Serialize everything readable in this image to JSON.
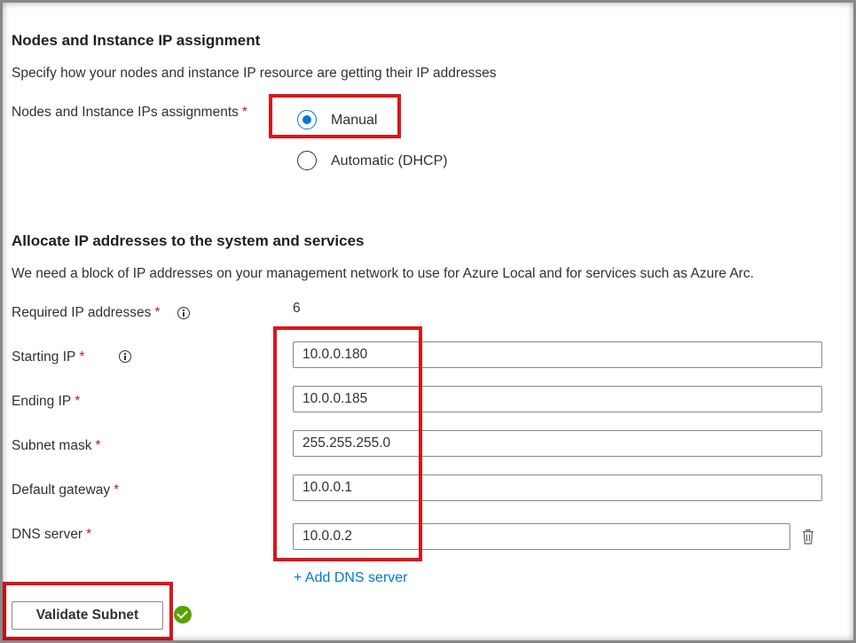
{
  "nodes_section": {
    "heading": "Nodes and Instance IP assignment",
    "description": "Specify how your nodes and instance IP resource are getting their IP addresses",
    "assignment_label": "Nodes and Instance IPs assignments",
    "required_marker": "*",
    "options": [
      {
        "label": "Manual",
        "selected": true
      },
      {
        "label": "Automatic (DHCP)",
        "selected": false
      }
    ]
  },
  "allocate_section": {
    "heading": "Allocate IP addresses to the system and services",
    "description": "We need a block of IP addresses on your management network to use for Azure Local and for services such as Azure Arc.",
    "required_ip_label": "Required IP addresses",
    "required_ip_value": "6",
    "fields": {
      "starting_ip": {
        "label": "Starting IP",
        "value": "10.0.0.180"
      },
      "ending_ip": {
        "label": "Ending IP",
        "value": "10.0.0.185"
      },
      "subnet_mask": {
        "label": "Subnet mask",
        "value": "255.255.255.0"
      },
      "default_gateway": {
        "label": "Default gateway",
        "value": "10.0.0.1"
      },
      "dns_server": {
        "label": "DNS server",
        "value": "10.0.0.2"
      }
    },
    "add_dns_link": "+ Add DNS server",
    "validate_button": "Validate Subnet"
  },
  "icons": {
    "info": "info-icon",
    "delete": "trash-icon",
    "validated": "checkmark-circle-icon"
  },
  "colors": {
    "accent": "#0078d4",
    "required": "#a4262c",
    "highlight_box": "#d9161e",
    "success": "#57a300"
  }
}
